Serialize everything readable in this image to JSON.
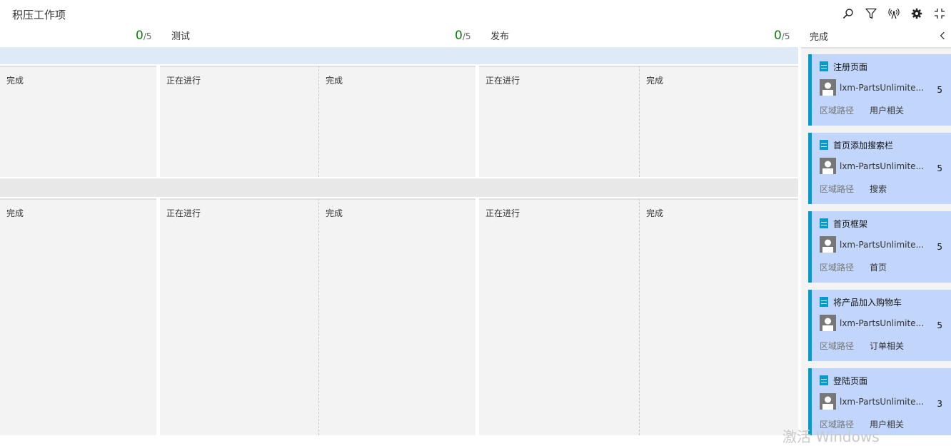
{
  "header": {
    "title": "积压工作项",
    "icons": [
      "search-icon",
      "filter-icon",
      "live-updates-icon",
      "gear-icon",
      "fullscreen-icon"
    ]
  },
  "columns": [
    {
      "name": "",
      "count": "0",
      "limit": "/5"
    },
    {
      "name": "测试",
      "count": "0",
      "limit": "/5"
    },
    {
      "name": "发布",
      "count": "0",
      "limit": "/5"
    }
  ],
  "subcolumns": {
    "done": "完成",
    "in_progress": "正在进行"
  },
  "done_panel": {
    "title": "完成"
  },
  "cards": [
    {
      "title": "注册页面",
      "assignee": "lxm-PartsUnlimite...",
      "effort": "5",
      "field_label": "区域路径",
      "field_value": "用户相关"
    },
    {
      "title": "首页添加搜索栏",
      "assignee": "lxm-PartsUnlimite...",
      "effort": "5",
      "field_label": "区域路径",
      "field_value": "搜索"
    },
    {
      "title": "首页框架",
      "assignee": "lxm-PartsUnlimite...",
      "effort": "5",
      "field_label": "区域路径",
      "field_value": "首页"
    },
    {
      "title": "将产品加入购物车",
      "assignee": "lxm-PartsUnlimite...",
      "effort": "5",
      "field_label": "区域路径",
      "field_value": "订单相关"
    },
    {
      "title": "登陆页面",
      "assignee": "lxm-PartsUnlimite...",
      "effort": "3",
      "field_label": "区域路径",
      "field_value": "用户相关"
    }
  ],
  "watermark": "激活 Windows",
  "colors": {
    "accent": "#009ccc",
    "card_bg": "#c2d5fa",
    "count": "#107c10"
  }
}
